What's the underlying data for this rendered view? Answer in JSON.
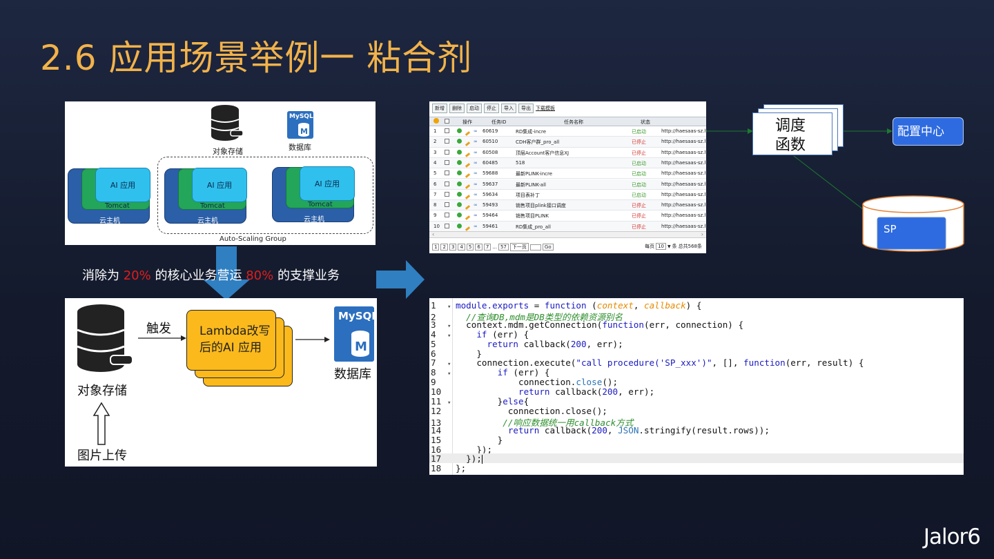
{
  "title": "2.6  应用场景举例一 粘合剂",
  "asg_diagram": {
    "object_storage_label": "对象存储",
    "mysql_label": "MySQL",
    "database_label": "数据库",
    "ai_app_label": "AI 应用",
    "tomcat_label": "Tomcat",
    "host_label": "云主机",
    "group_label": "Auto-Scaling Group"
  },
  "task_table": {
    "toolbar": [
      "新增",
      "删除",
      "启动",
      "停止",
      "导入",
      "导出"
    ],
    "toolbar_link": "下载模板",
    "headers": {
      "ops": "操作",
      "id": "任务ID",
      "name": "任务名称",
      "status": "状态"
    },
    "rows": [
      {
        "no": "1",
        "id": "60619",
        "name": "RD集成-incre",
        "status": "已启动",
        "status_type": "run",
        "url": "http://haesaas-sz.huaw"
      },
      {
        "no": "2",
        "id": "60510",
        "name": "CDH客户群_pro_all",
        "status": "已停止",
        "status_type": "stop",
        "url": "http://haesaas-sz.huaw"
      },
      {
        "no": "3",
        "id": "60508",
        "name": "顶层Account客户信息XJ",
        "status": "已停止",
        "status_type": "stop",
        "url": "http://haesaas-sz.huaw"
      },
      {
        "no": "4",
        "id": "60485",
        "name": "518",
        "status": "已启动",
        "status_type": "run",
        "url": "http://haesaas-sz.huaw"
      },
      {
        "no": "5",
        "id": "59688",
        "name": "最新PLINK-incre",
        "status": "已启动",
        "status_type": "run",
        "url": "http://haesaas-sz.huaw"
      },
      {
        "no": "6",
        "id": "59637",
        "name": "最新PLINK-all",
        "status": "已启动",
        "status_type": "run",
        "url": "http://haesaas-sz.huaw"
      },
      {
        "no": "7",
        "id": "59634",
        "name": "项目表补丁",
        "status": "已启动",
        "status_type": "run",
        "url": "http://haesaas-sz.huaw"
      },
      {
        "no": "8",
        "id": "59493",
        "name": "销售项目plink接口调度",
        "status": "已停止",
        "status_type": "stop",
        "url": "http://haesaas-sz.huaw"
      },
      {
        "no": "9",
        "id": "59464",
        "name": "销售项目PLINK",
        "status": "已停止",
        "status_type": "stop",
        "url": "http://haesaas-sz.huaw"
      },
      {
        "no": "10",
        "id": "59461",
        "name": "RD集成_pro_all",
        "status": "已停止",
        "status_type": "stop",
        "url": "http://haesaas-sz.huaw"
      }
    ],
    "pager": {
      "pages": [
        "1",
        "2",
        "3",
        "4",
        "5",
        "6",
        "7"
      ],
      "ellipsis": "...",
      "last": "57",
      "next": "下一页",
      "go": "Go",
      "per_page_prefix": "每页",
      "per_page_value": "10",
      "per_page_suffix": "条",
      "total": "总共568条"
    }
  },
  "flow": {
    "schedule_func": "调度\n函数",
    "config_center": "配置中心",
    "sp": "SP"
  },
  "caption": {
    "part1": "消除为 ",
    "pct1": "20%",
    "part2": " 的核心业务营运 ",
    "pct2": "80%",
    "part3": " 的支撑业务"
  },
  "lambda_diagram": {
    "object_storage_label": "对象存储",
    "trigger_label": "触发",
    "lambda_label": "Lambda改写\n后的AI 应用",
    "mysql_label": "MySQL",
    "database_label": "数据库",
    "upload_label": "图片上传"
  },
  "code": [
    {
      "n": "1",
      "fold": "▾",
      "html": "<span class='kw'>module.exports</span> = <span class='kw'>function</span> (<span class='param'>context</span>, <span class='param'>callback</span>) {"
    },
    {
      "n": "2",
      "fold": "",
      "html": "  <span class='cm'>//查询DB,mdm是DB类型的依赖资源别名</span>"
    },
    {
      "n": "3",
      "fold": "▾",
      "html": "  context.mdm.getConnection(<span class='kw'>function</span>(err, connection) {"
    },
    {
      "n": "4",
      "fold": "▾",
      "html": "    <span class='kw'>if</span> (err) {"
    },
    {
      "n": "5",
      "fold": "",
      "html": "      <span class='kw'>return</span> callback(<span class='num'>200</span>, err);"
    },
    {
      "n": "6",
      "fold": "",
      "html": "    }"
    },
    {
      "n": "7",
      "fold": "▾",
      "html": "    connection.execute(<span class='str'>\"call procedure('SP_xxx')\"</span>, [], <span class='kw'>function</span>(err, result) {"
    },
    {
      "n": "8",
      "fold": "▾",
      "html": "        <span class='kw'>if</span> (err) {"
    },
    {
      "n": "9",
      "fold": "",
      "html": "            connection.<span class='jsonc'>close</span>();"
    },
    {
      "n": "10",
      "fold": "",
      "html": "            <span class='kw'>return</span> callback(<span class='num'>200</span>, err);"
    },
    {
      "n": "11",
      "fold": "▾",
      "html": "        }<span class='kw'>else</span>{"
    },
    {
      "n": "12",
      "fold": "",
      "html": "          connection.close();"
    },
    {
      "n": "13",
      "fold": "",
      "html": "         <span class='cm'>//响应数据统一用callback方式</span>"
    },
    {
      "n": "14",
      "fold": "",
      "html": "          <span class='kw'>return</span> callback(<span class='num'>200</span>, <span class='jsonc'>JSON</span>.stringify(result.rows));"
    },
    {
      "n": "15",
      "fold": "",
      "html": "        }"
    },
    {
      "n": "16",
      "fold": "",
      "html": "    });"
    },
    {
      "n": "17",
      "fold": "",
      "html": "  });",
      "hl": true
    },
    {
      "n": "18",
      "fold": "",
      "html": "};"
    }
  ],
  "logo": "Jalor6",
  "colors": {
    "title": "#f2b24a",
    "accent_red": "#e21c1c",
    "arrow_blue": "#2f7fc1",
    "lambda_yellow": "#fbb91c"
  }
}
